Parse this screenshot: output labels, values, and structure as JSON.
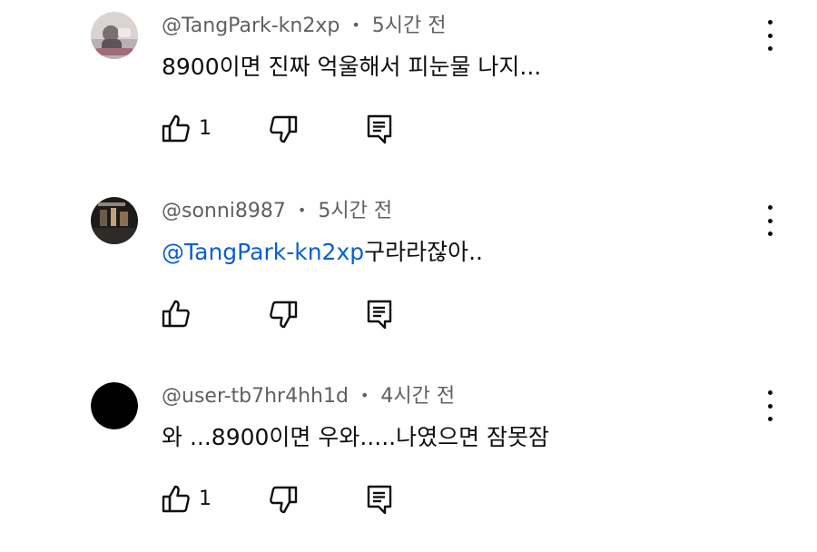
{
  "comments": [
    {
      "handle": "@TangPark-kn2xp",
      "separator": "•",
      "time": "5시간 전",
      "mention": "",
      "text": "8900이면 진짜 억울해서 피눈물 나지...",
      "likes": "1",
      "avatar": "photo-avatar"
    },
    {
      "handle": "@sonni8987",
      "separator": "•",
      "time": "5시간 전",
      "mention": "@TangPark-kn2xp",
      "text": "구라라잖아..",
      "likes": "",
      "avatar": "dark-photo-avatar"
    },
    {
      "handle": "@user-tb7hr4hh1d",
      "separator": "•",
      "time": "4시간 전",
      "mention": "",
      "text": "와 ...8900이면 우와.....나였으면 잠못잠",
      "likes": "1",
      "avatar": "black-circle-avatar"
    }
  ],
  "colors": {
    "meta": "#606060",
    "text": "#0f0f0f",
    "mention": "#065fd4"
  },
  "icons": {
    "like": "thumbs-up-icon",
    "dislike": "thumbs-down-icon",
    "reply": "reply-icon",
    "more": "more-vertical-icon"
  }
}
